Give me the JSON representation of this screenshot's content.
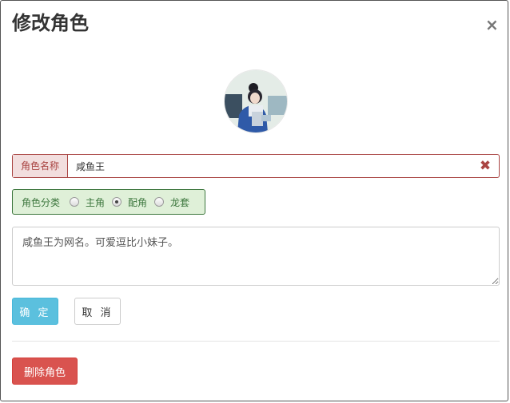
{
  "modal": {
    "title": "修改角色",
    "close_glyph": "×"
  },
  "avatar": {
    "icon": "user-avatar-photo"
  },
  "name_field": {
    "label": "角色名称",
    "value": "咸鱼王",
    "clear_glyph": "✖",
    "state_color": "#a94442"
  },
  "category": {
    "label": "角色分类",
    "options": [
      {
        "label": "主角",
        "checked": false
      },
      {
        "label": "配角",
        "checked": true
      },
      {
        "label": "龙套",
        "checked": false
      }
    ],
    "state_color": "#3c763d"
  },
  "description": {
    "value": "咸鱼王为网名。可爱逗比小妹子。"
  },
  "buttons": {
    "ok": "确 定",
    "cancel": "取 消",
    "delete": "删除角色"
  },
  "colors": {
    "info": "#5bc0de",
    "danger": "#d9534f"
  }
}
